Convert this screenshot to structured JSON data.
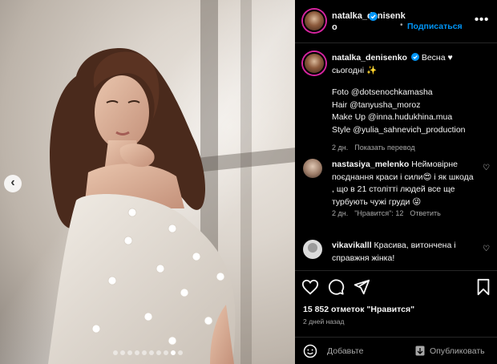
{
  "post": {
    "carousel": {
      "total_slides": 10,
      "active_index": 8,
      "prev_icon": "chevron-left-icon"
    },
    "author": {
      "username": "natalka_denisenko",
      "verified": true,
      "follow_label": "Подписаться",
      "more_icon": "more-horizontal-icon"
    },
    "caption": {
      "username": "natalka_denisenko",
      "text_line1": "Весна ♥",
      "text_line2": "сьогодні ✨",
      "credits": [
        "Foto @dotsenochkamasha",
        "Hair @tanyusha_moroz",
        "Make Up @inna.hudukhina.mua",
        "Style @yulia_sahnevich_production"
      ],
      "time": "2 дн.",
      "translate_label": "Показать перевод"
    },
    "comments": [
      {
        "username": "nastasiya_melenko",
        "text": "Неймовірне поєднання краси і сили😍 і як шкода , що в 21 столітті людей все ще турбують чужі груди 😜",
        "time": "2 дн.",
        "likes_label": "\"Нравится\": 12",
        "reply_label": "Ответить"
      },
      {
        "username": "vikavikalll",
        "text": "Красива, витончена і справжня жінка!",
        "time": "",
        "likes_label": "",
        "reply_label": ""
      }
    ],
    "likes_text": "15 852 отметок \"Нравится\"",
    "posted_time": "2 дней назад",
    "add_comment_placeholder": "Добавьте",
    "publish_label": "Опубликовать",
    "colors": {
      "follow_blue": "#0095f6",
      "verified_blue": "#0095f6",
      "story_ring": "#d6249f"
    }
  }
}
